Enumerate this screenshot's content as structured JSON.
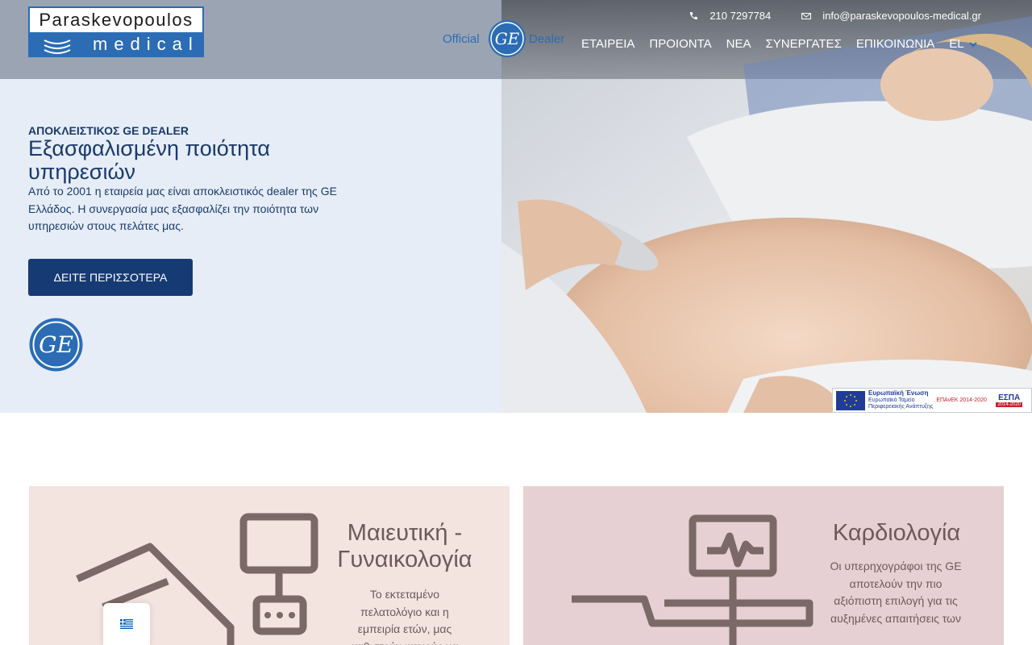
{
  "header": {
    "logo_top": "Paraskevopoulos",
    "logo_bottom": "medical",
    "official_left": "Official",
    "official_right": "Dealer",
    "phone": "210 7297784",
    "email": "info@paraskevopoulos-medical.gr",
    "nav": [
      "ΕΤΑΙΡΕΙΑ",
      "ΠΡΟΙΟΝΤΑ",
      "ΝΕΑ",
      "ΣΥΝΕΡΓΑΤΕΣ",
      "ΕΠΙΚΟΙΝΩΝΙΑ"
    ],
    "lang": "EL"
  },
  "hero": {
    "kicker": "ΑΠΟΚΛΕΙΣΤΙΚΟΣ GE DEALER",
    "headline": "Εξασφαλισμένη ποιότητα υπηρεσιών",
    "lead": "Από το 2001 η εταιρεία μας είναι αποκλειστικός dealer της GE Ελλάδος. Η συνεργασία μας εξασφαλίζει την ποιότητα των υπηρεσιών στους πελάτες μας.",
    "cta": "ΔΕΙΤΕ ΠΕΡΙΣΣΟΤΕΡΑ"
  },
  "espa": {
    "eu_title": "Ευρωπαϊκή Ένωση",
    "eu_sub1": "Ευρωπαϊκό Ταμείο",
    "eu_sub2": "Περιφερειακής Ανάπτυξης",
    "epanek": "ΕΠΑνΕΚ 2014-2020",
    "espa_logo": "ΕΣΠΑ",
    "espa_years": "2014-2020"
  },
  "cards": [
    {
      "title": "Μαιευτική - Γυναικολογία",
      "text": "Το εκτεταμένο πελατολόγιο και η εμπειρία ετών, μας καθιστούν ικανούς να"
    },
    {
      "title": "Καρδιολογία",
      "text": "Οι υπερηχογράφοι της GE αποτελούν την πιο αξιόπιστη επιλογή για τις αυξημένες απαιτήσεις των"
    }
  ],
  "colors": {
    "brand_blue": "#2b6cb5",
    "navy": "#163a73",
    "hero_bg": "#e6edf7",
    "card1_bg": "#f3e4e0",
    "card2_bg": "#e7d0d3"
  }
}
